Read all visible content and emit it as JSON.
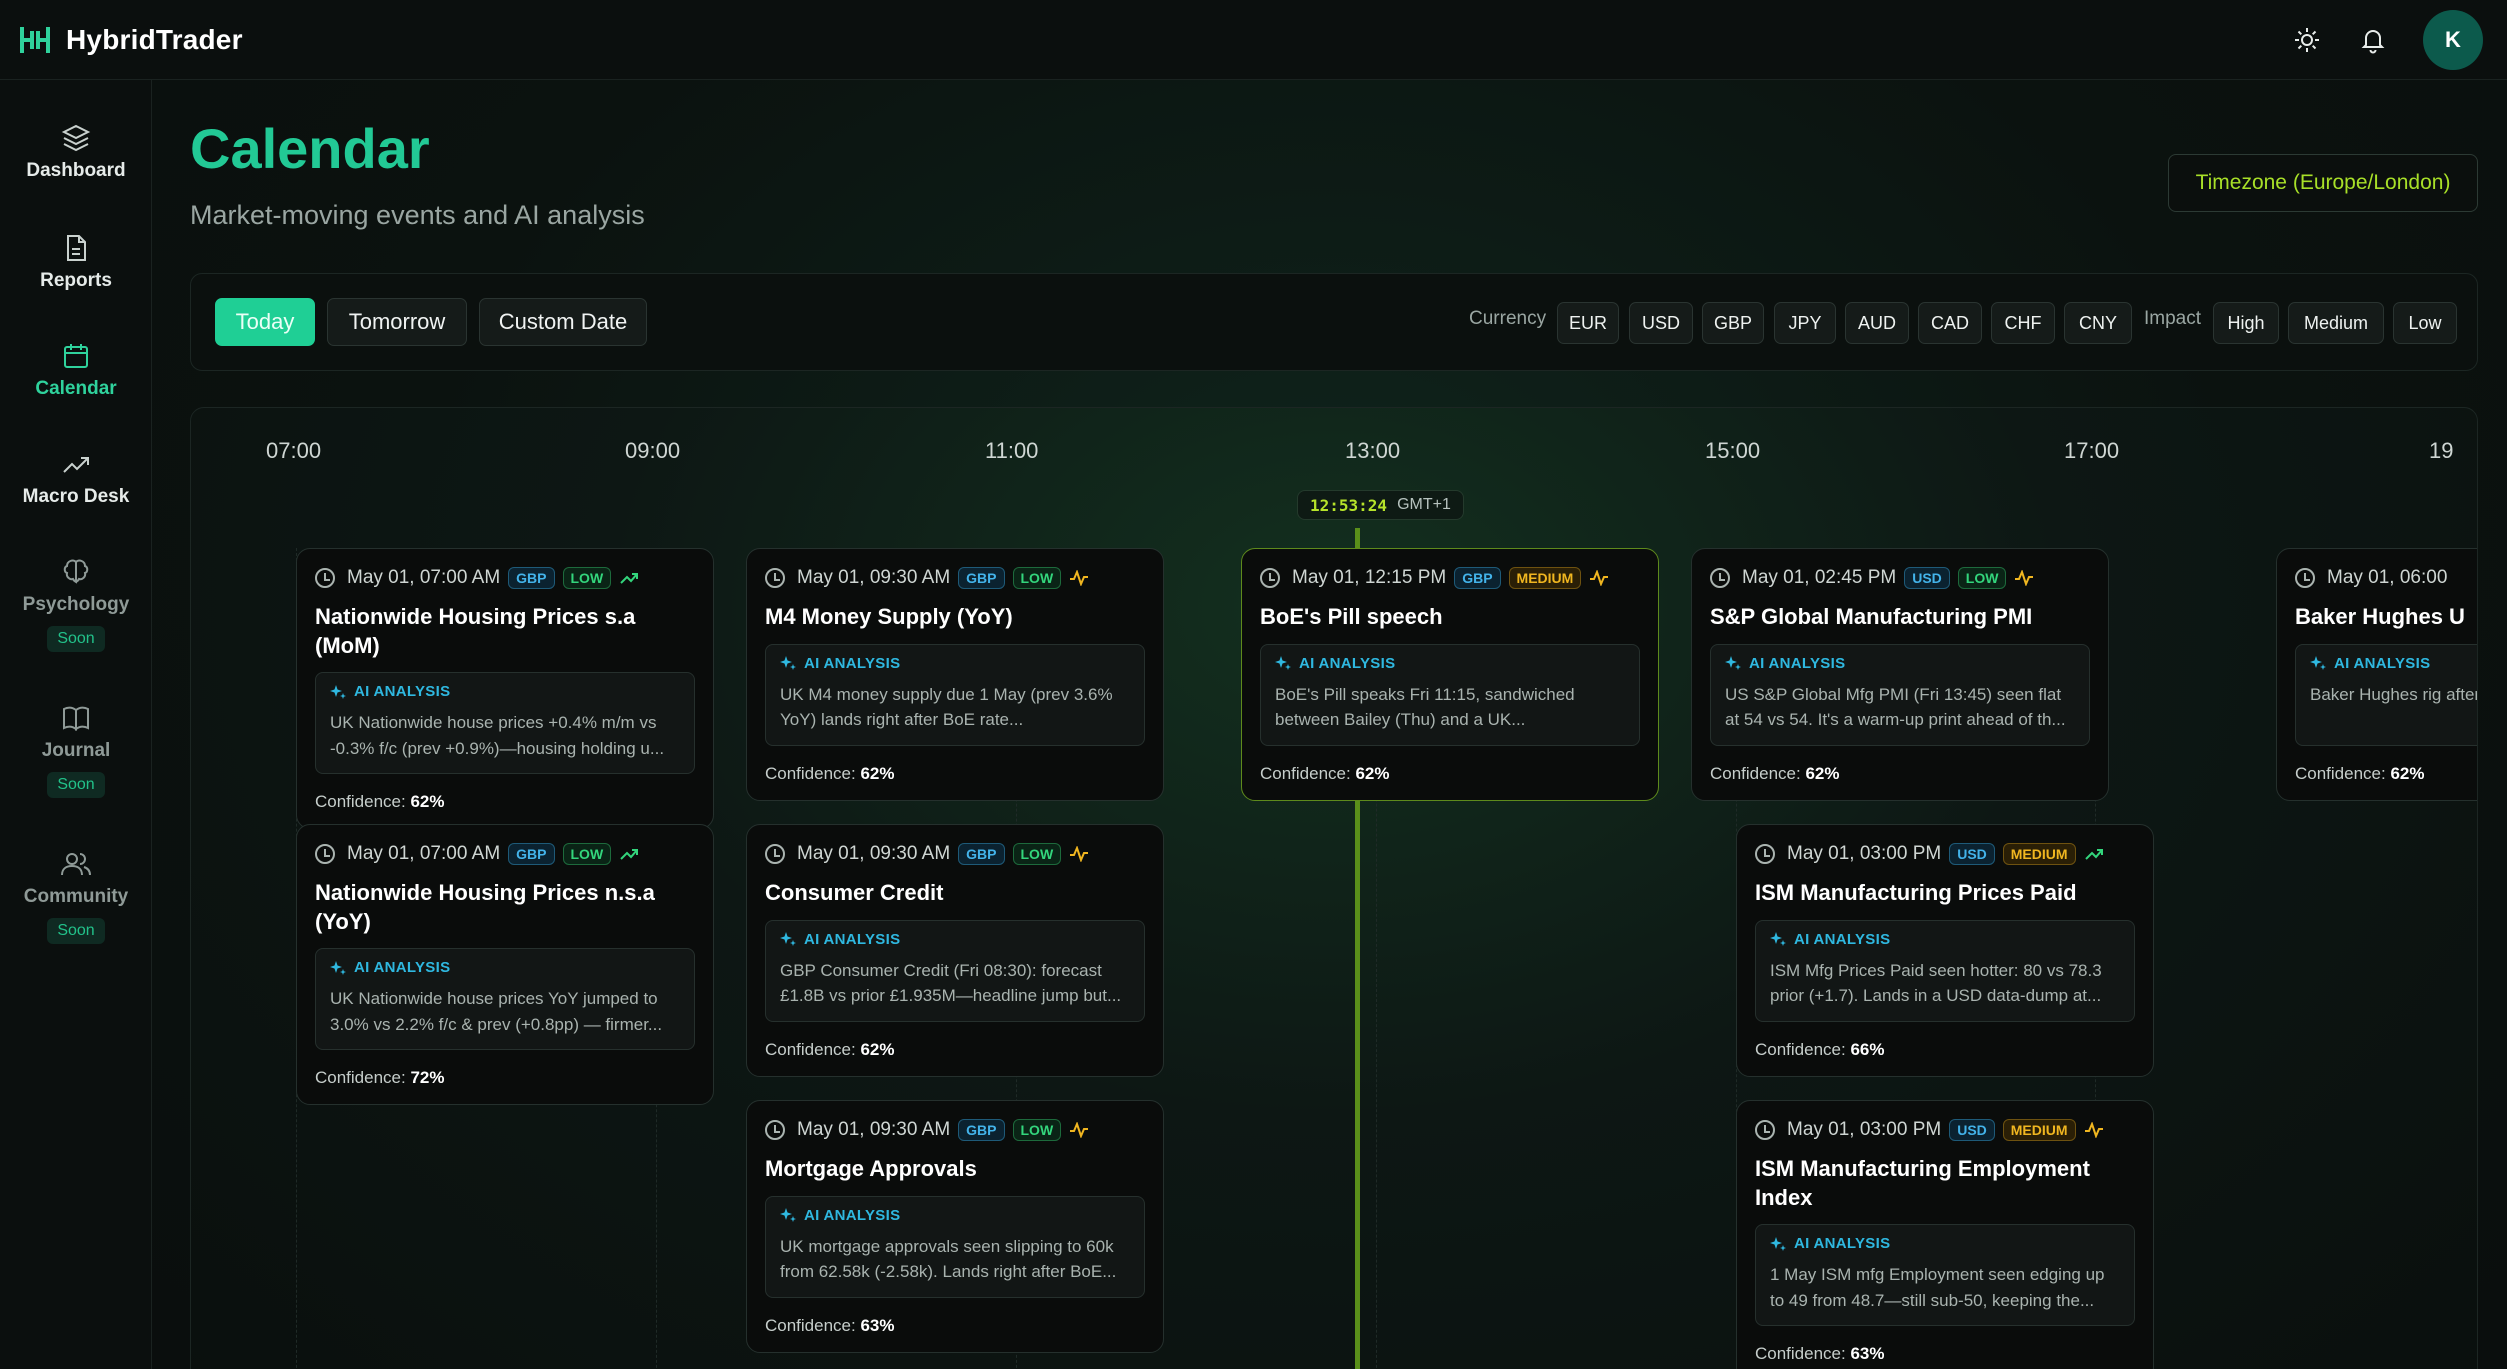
{
  "app": {
    "name": "HybridTrader",
    "avatar_initial": "K"
  },
  "nav": [
    {
      "label": "Dashboard",
      "icon": "layers-icon"
    },
    {
      "label": "Reports",
      "icon": "document-icon"
    },
    {
      "label": "Calendar",
      "icon": "calendar-icon",
      "active": true
    },
    {
      "label": "Macro Desk",
      "icon": "trend-up-icon"
    },
    {
      "label": "Psychology",
      "icon": "brain-icon",
      "badge": "Soon"
    },
    {
      "label": "Journal",
      "icon": "book-icon",
      "badge": "Soon"
    },
    {
      "label": "Community",
      "icon": "users-icon",
      "badge": "Soon"
    }
  ],
  "page": {
    "title": "Calendar",
    "subtitle": "Market-moving events and AI analysis",
    "timezone_label": "Timezone (Europe/London)"
  },
  "filters": {
    "days": [
      "Today",
      "Tomorrow",
      "Custom Date"
    ],
    "currency_label": "Currency",
    "currencies": [
      "EUR",
      "USD",
      "GBP",
      "JPY",
      "AUD",
      "CAD",
      "CHF",
      "CNY"
    ],
    "impact_label": "Impact",
    "impacts": [
      "High",
      "Medium",
      "Low"
    ]
  },
  "timeline": {
    "ticks": [
      "07:00",
      "09:00",
      "11:00",
      "13:00",
      "15:00",
      "17:00",
      "19"
    ],
    "now_time": "12:53:24",
    "now_tz": "GMT+1"
  },
  "ai_label": "AI ANALYSIS",
  "confidence_label": "Confidence:",
  "events": [
    {
      "time": "May 01, 07:00 AM",
      "currency": "GBP",
      "impact": "LOW",
      "trend_icon": "trend-up-icon",
      "title": "Nationwide Housing Prices s.a (MoM)",
      "analysis": "UK Nationwide house prices +0.4% m/m vs -0.3% f/c (prev +0.9%)—housing holding u...",
      "confidence": "62%"
    },
    {
      "time": "May 01, 07:00 AM",
      "currency": "GBP",
      "impact": "LOW",
      "trend_icon": "trend-up-icon",
      "title": "Nationwide Housing Prices n.s.a (YoY)",
      "analysis": "UK Nationwide house prices YoY jumped to 3.0% vs 2.2% f/c & prev (+0.8pp) — firmer...",
      "confidence": "72%"
    },
    {
      "time": "May 01, 09:30 AM",
      "currency": "GBP",
      "impact": "LOW",
      "trend_icon": "pulse-icon",
      "title": "M4 Money Supply (YoY)",
      "analysis": "UK M4 money supply due 1 May (prev 3.6% YoY) lands right after BoE rate...",
      "confidence": "62%"
    },
    {
      "time": "May 01, 09:30 AM",
      "currency": "GBP",
      "impact": "LOW",
      "trend_icon": "pulse-icon",
      "title": "Consumer Credit",
      "analysis": "GBP Consumer Credit (Fri 08:30): forecast £1.8B vs prior £1.935M—headline jump but...",
      "confidence": "62%"
    },
    {
      "time": "May 01, 09:30 AM",
      "currency": "GBP",
      "impact": "LOW",
      "trend_icon": "pulse-icon",
      "title": "Mortgage Approvals",
      "analysis": "UK mortgage approvals seen slipping to 60k from 62.58k (-2.58k). Lands right after BoE...",
      "confidence": "63%"
    },
    {
      "time": "May 01, 12:15 PM",
      "currency": "GBP",
      "impact": "MEDIUM",
      "trend_icon": "pulse-icon",
      "title": "BoE's Pill speech",
      "analysis": "BoE's Pill speaks Fri 11:15, sandwiched between Bailey (Thu) and a UK...",
      "confidence": "62%"
    },
    {
      "time": "May 01, 02:45 PM",
      "currency": "USD",
      "impact": "LOW",
      "trend_icon": "pulse-icon",
      "title": "S&P Global Manufacturing PMI",
      "analysis": "US S&P Global Mfg PMI (Fri 13:45) seen flat at 54 vs 54. It's a warm-up print ahead of th...",
      "confidence": "62%"
    },
    {
      "time": "May 01, 03:00 PM",
      "currency": "USD",
      "impact": "MEDIUM",
      "trend_icon": "trend-up-icon",
      "title": "ISM Manufacturing Prices Paid",
      "analysis": "ISM Mfg Prices Paid seen hotter: 80 vs 78.3 prior (+1.7). Lands in a USD data-dump at...",
      "confidence": "66%"
    },
    {
      "time": "May 01, 03:00 PM",
      "currency": "USD",
      "impact": "MEDIUM",
      "trend_icon": "pulse-icon",
      "title": "ISM Manufacturing Employment Index",
      "analysis": "1 May ISM mfg Employment seen edging up to 49 from 48.7—still sub-50, keeping the...",
      "confidence": "63%"
    },
    {
      "time": "May 01, 06:00",
      "currency": "",
      "impact": "",
      "trend_icon": "",
      "title": "Baker Hughes U",
      "analysis": "Baker Hughes rig after a heavy USD",
      "confidence": "62%"
    }
  ],
  "colors": {
    "accent": "#22c995",
    "now_line": "#5a8f1a",
    "lime": "#a8e028"
  }
}
